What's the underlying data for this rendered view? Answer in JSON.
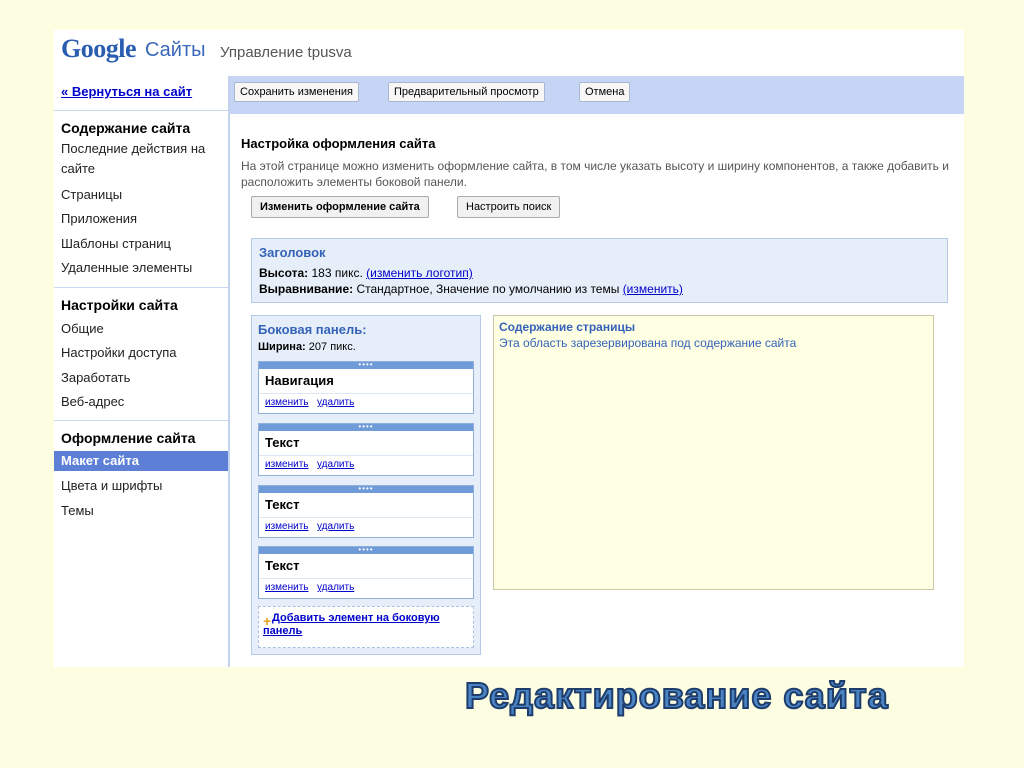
{
  "topbar": {
    "logo_text": "Google",
    "app_name": "Сайты",
    "site_manage": "Управление tpusva"
  },
  "sidebar": {
    "back_link": "« Вернуться на сайт",
    "groups": [
      {
        "title": "Содержание сайта",
        "items": [
          {
            "label": "Последние действия на сайте"
          },
          {
            "label": "Страницы"
          },
          {
            "label": "Приложения"
          },
          {
            "label": "Шаблоны страниц"
          },
          {
            "label": "Удаленные элементы"
          }
        ]
      },
      {
        "title": "Настройки сайта",
        "items": [
          {
            "label": "Общие"
          },
          {
            "label": "Настройки доступа"
          },
          {
            "label": "Заработать"
          },
          {
            "label": "Веб-адрес"
          }
        ]
      },
      {
        "title": "Оформление сайта",
        "items": [
          {
            "label": "Макет сайта",
            "active": true
          },
          {
            "label": "Цвета и шрифты"
          },
          {
            "label": "Темы"
          }
        ]
      }
    ]
  },
  "actionbar": {
    "save": "Сохранить изменения",
    "preview": "Предварительный просмотр",
    "cancel": "Отмена"
  },
  "main": {
    "title": "Настройка оформления сайта",
    "description": "На этой странице можно изменить оформление сайта, в том числе указать высоту и ширину компонентов, а также добавить и расположить элементы боковой панели.",
    "change_layout_button": "Изменить оформление сайта",
    "configure_search_button": "Настроить поиск"
  },
  "header_section": {
    "title": "Заголовок",
    "height_label": "Высота:",
    "height_value": " 183 пикс. ",
    "change_logo_link": "(изменить логотип)",
    "align_label": "Выравнивание:",
    "align_value": " Стандартное, Значение по умолчанию из темы ",
    "change_link": "(изменить)"
  },
  "side_panel": {
    "title": "Боковая панель:",
    "width_label": "Ширина:",
    "width_value": " 207 пикс.",
    "widgets": [
      {
        "title": "Навигация",
        "edit": "изменить",
        "delete": "удалить"
      },
      {
        "title": "Текст",
        "edit": "изменить",
        "delete": "удалить"
      },
      {
        "title": "Текст",
        "edit": "изменить",
        "delete": "удалить"
      },
      {
        "title": "Текст",
        "edit": "изменить",
        "delete": "удалить"
      }
    ],
    "add_icon": "+",
    "add_link": "Добавить элемент на боковую панель",
    "handle_dots": "••••"
  },
  "content_area": {
    "title": "Содержание страницы",
    "description": "Эта область зарезервирована под содержание сайта"
  },
  "caption": "Редактирование сайта",
  "colors": {
    "slide_bg": "#fdfde1",
    "accent": "#5d7fd6",
    "actionbar_bg": "#c6d5f6",
    "caption": "#4a84c4"
  }
}
